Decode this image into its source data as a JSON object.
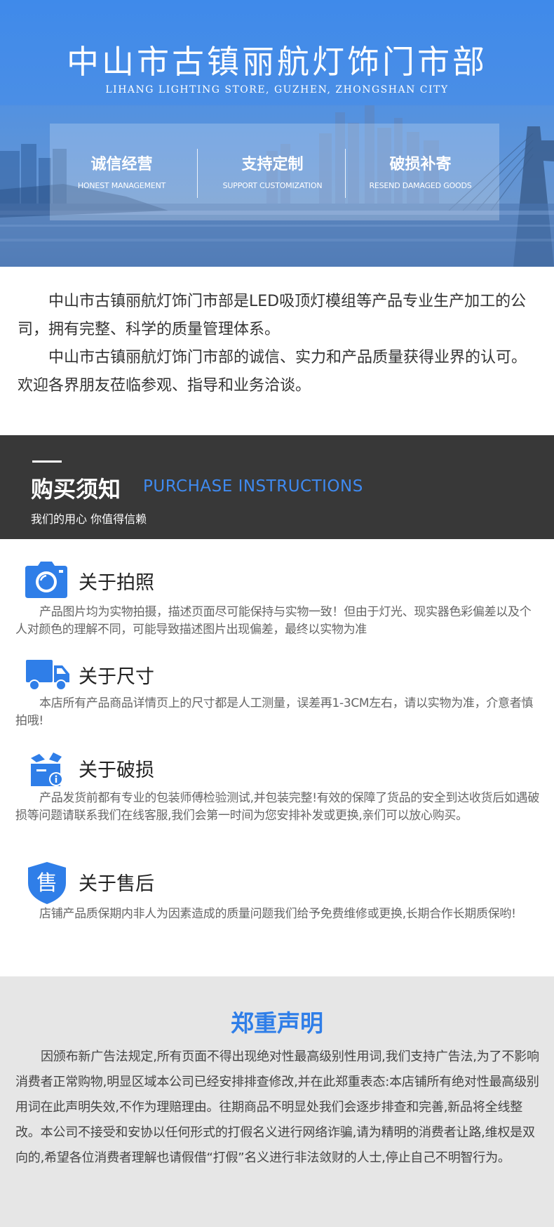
{
  "hero": {
    "title": "中山市古镇丽航灯饰门市部",
    "subtitle": "LIHANG LIGHTING STORE, GUZHEN, ZHONGSHAN CITY",
    "features": [
      {
        "title": "诚信经营",
        "en": "HONEST MANAGEMENT"
      },
      {
        "title": "支持定制",
        "en": "SUPPORT CUSTOMIZATION"
      },
      {
        "title": "破损补寄",
        "en": "RESEND DAMAGED GOODS"
      }
    ]
  },
  "intro": {
    "p1": "中山市古镇丽航灯饰门市部是LED吸顶灯模组等产品专业生产加工的公司，拥有完整、科学的质量管理体系。",
    "p2": "中山市古镇丽航灯饰门市部的诚信、实力和产品质量获得业界的认可。欢迎各界朋友莅临参观、指导和业务洽谈。"
  },
  "purchase": {
    "title": "购买须知",
    "title_en": "PURCHASE INSTRUCTIONS",
    "subtitle": "我们的用心 你值得信赖"
  },
  "sections": [
    {
      "icon": "camera-icon",
      "title": "关于拍照",
      "text": "产品图片均为实物拍摄，描述页面尽可能保持与实物一致！但由于灯光、现实器色彩偏差以及个人对颜色的理解不同，可能导致描述图片出现偏差，最终以实物为准"
    },
    {
      "icon": "truck-icon",
      "title": "关于尺寸",
      "text": "本店所有产品商品详情页上的尺寸都是人工测量，误差再1-3CM左右，请以实物为准，介意者慎拍哦!"
    },
    {
      "icon": "damaged-box-icon",
      "title": "关于破损",
      "text": "产品发货前都有专业的包装师傅检验测试,并包装完整!有效的保障了货品的安全到达收货后如遇破损等问题请联系我们在线客服,我们会第一时间为您安排补发或更换,亲们可以放心购买。"
    },
    {
      "icon": "after-sale-shield-icon",
      "icon_glyph": "售",
      "title": "关于售后",
      "text": "店铺产品质保期内非人为因素造成的质量问题我们给予免费维修或更换,长期合作长期质保哟!"
    }
  ],
  "declaration": {
    "title": "郑重声明",
    "text": "因颁布新广告法规定,所有页面不得出现绝对性最高级别性用词,我们支持广告法,为了不影响消费者正常购物,明显区域本公司已经安排排查修改,并在此郑重表态:本店铺所有绝对性最高级别用词在此声明失效,不作为理赔理由。往期商品不明显处我们会逐步排查和完善,新品将全线整改。本公司不接受和安协以任何形式的打假名义进行网络诈骗,请为精明的消费者让路,维权是双向的,希望各位消费者理解也请假借“打假”名义进行非法敛财的人士,停止自己不明智行为。"
  },
  "colors": {
    "accent_blue": "#2f7ee8",
    "dark_bar": "#383838",
    "decl_bg": "#e6e6e6"
  }
}
